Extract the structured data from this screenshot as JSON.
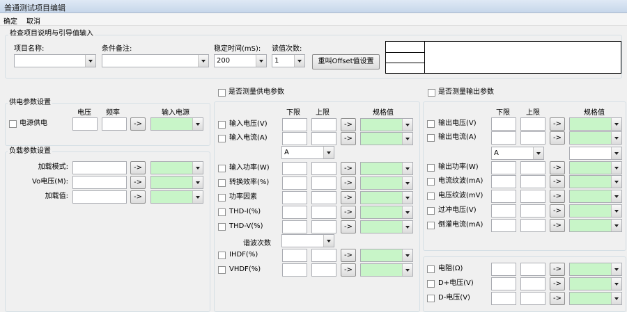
{
  "window": {
    "title": "普通测试项目编辑"
  },
  "menu": {
    "confirm": "确定",
    "cancel": "取消"
  },
  "top": {
    "group_title": "检查项目说明与引导值输入",
    "name_label": "项目名称:",
    "name_value": "",
    "cond_label": "条件备注:",
    "cond_value": "",
    "stable_label": "稳定时间(mS):",
    "stable_value": "200",
    "read_label": "读值次数:",
    "read_value": "1",
    "offset_btn": "重叫Offset值设置"
  },
  "supply": {
    "group_title": "供电参数设置",
    "h_voltage": "电压",
    "h_freq": "频率",
    "h_input_voltage": "输入电源",
    "power_label": "电源供电",
    "arrow": "->"
  },
  "load": {
    "group_title": "负载参数设置",
    "rows": [
      {
        "label": "加载模式:"
      },
      {
        "label": "Vo电压(M):"
      },
      {
        "label": "加载值:"
      }
    ]
  },
  "input_section": {
    "check_label": "是否测量供电参数",
    "h_lower": "下限",
    "h_upper": "上限",
    "h_spec": "规格值",
    "unit_value": "A",
    "rows": [
      {
        "label": "输入电压(V)"
      },
      {
        "label": "输入电流(A)"
      },
      {
        "label": "输入功率(W)"
      },
      {
        "label": "转换效率(%)"
      },
      {
        "label": "功率因素"
      },
      {
        "label": "THD-I(%)"
      },
      {
        "label": "THD-V(%)"
      }
    ],
    "harmonic_label": "谐波次数",
    "ihdf": "IHDF(%)",
    "vhdf": "VHDF(%)"
  },
  "output_section": {
    "check_label": "是否测量输出参数",
    "h_lower": "下限",
    "h_upper": "上限",
    "h_spec": "规格值",
    "unit_value": "A",
    "rows": [
      {
        "label": "输出电压(V)"
      },
      {
        "label": "输出电流(A)"
      },
      {
        "label": "输出功率(W)"
      },
      {
        "label": "电流纹波(mA)"
      },
      {
        "label": "电压纹波(mV)"
      },
      {
        "label": "过冲电压(V)"
      },
      {
        "label": "倒灌电流(mA)"
      }
    ]
  },
  "extra_section": {
    "rows": [
      {
        "label": "电阻(Ω)"
      },
      {
        "label": "D+电压(V)"
      },
      {
        "label": "D-电压(V)"
      }
    ]
  },
  "colors": {
    "spec_field": "#c8f5c8",
    "titlebar": "#c6d6ea"
  }
}
